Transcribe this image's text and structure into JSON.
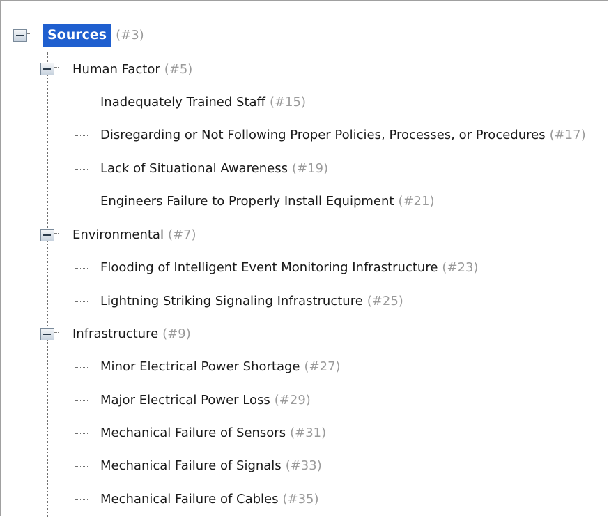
{
  "tree": {
    "root": {
      "label": "Sources",
      "count": "(#3)",
      "toggle_icon": "minus-box-icon"
    },
    "groups": [
      {
        "label": "Human Factor",
        "count": "(#5)",
        "items": [
          {
            "label": "Inadequately Trained Staff",
            "count": "(#15)"
          },
          {
            "label": "Disregarding or Not Following Proper Policies, Processes, or Procedures",
            "count": "(#17)"
          },
          {
            "label": "Lack of Situational Awareness",
            "count": "(#19)"
          },
          {
            "label": "Engineers Failure to Properly Install Equipment",
            "count": "(#21)"
          }
        ]
      },
      {
        "label": "Environmental",
        "count": "(#7)",
        "items": [
          {
            "label": "Flooding of Intelligent Event Monitoring Infrastructure",
            "count": "(#23)"
          },
          {
            "label": "Lightning Striking Signaling Infrastructure",
            "count": "(#25)"
          }
        ]
      },
      {
        "label": "Infrastructure",
        "count": "(#9)",
        "items": [
          {
            "label": "Minor Electrical Power Shortage",
            "count": "(#27)"
          },
          {
            "label": "Major Electrical Power Loss",
            "count": "(#29)"
          },
          {
            "label": "Mechanical Failure of Sensors",
            "count": "(#31)"
          },
          {
            "label": "Mechanical Failure of Signals",
            "count": "(#33)"
          },
          {
            "label": "Mechanical Failure of Cables",
            "count": "(#35)"
          }
        ]
      }
    ]
  },
  "colors": {
    "selection": "#1f5fcf",
    "count_text": "#9a9a9a",
    "label_text": "#1a1a1a"
  }
}
